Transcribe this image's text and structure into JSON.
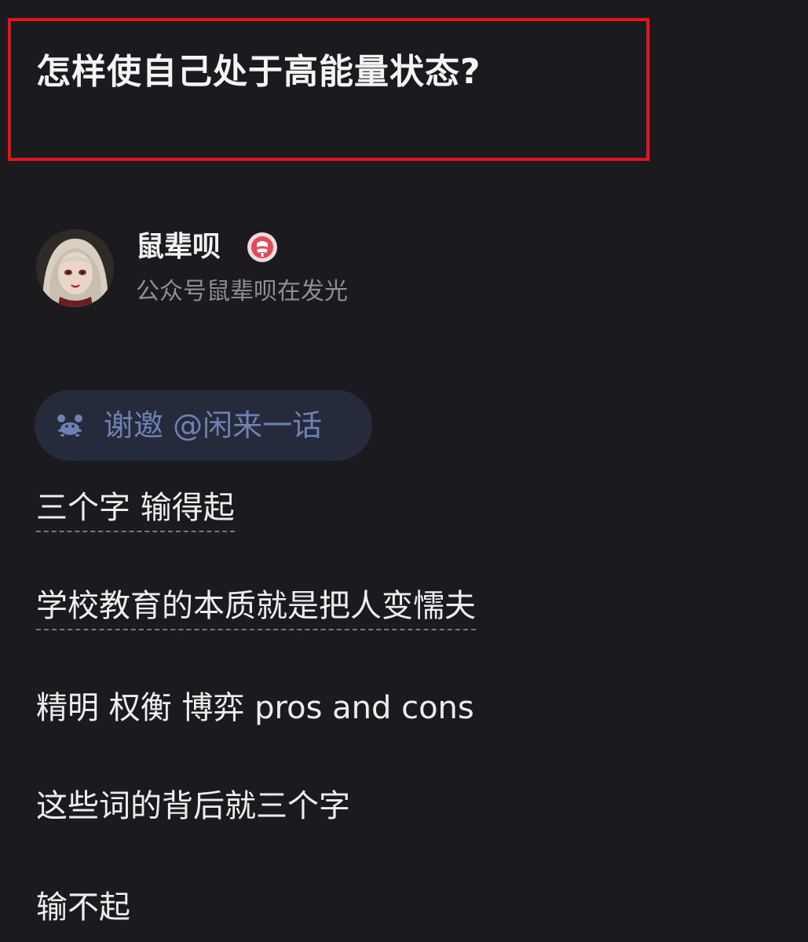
{
  "question": {
    "title": "怎样使自己处于高能量状态?"
  },
  "author": {
    "name": "鼠辈呗",
    "bio": "公众号鼠辈呗在发光",
    "badge_icon": "verified-badge-icon",
    "avatar": "avatar-illustration"
  },
  "invite": {
    "icon": "crab-icon",
    "text": "谢邀 @闲来一话"
  },
  "answer": {
    "lines": [
      "三个字 输得起",
      "学校教育的本质就是把人变懦夫",
      "精明 权衡 博弈 pros and cons",
      "这些词的背后就三个字",
      "输不起"
    ]
  },
  "colors": {
    "background": "#1b1b1f",
    "highlight_border": "#e3141b",
    "invite_chip": "#252b3a",
    "invite_text": "#6f80b2",
    "secondary_text": "#8e8e93"
  }
}
